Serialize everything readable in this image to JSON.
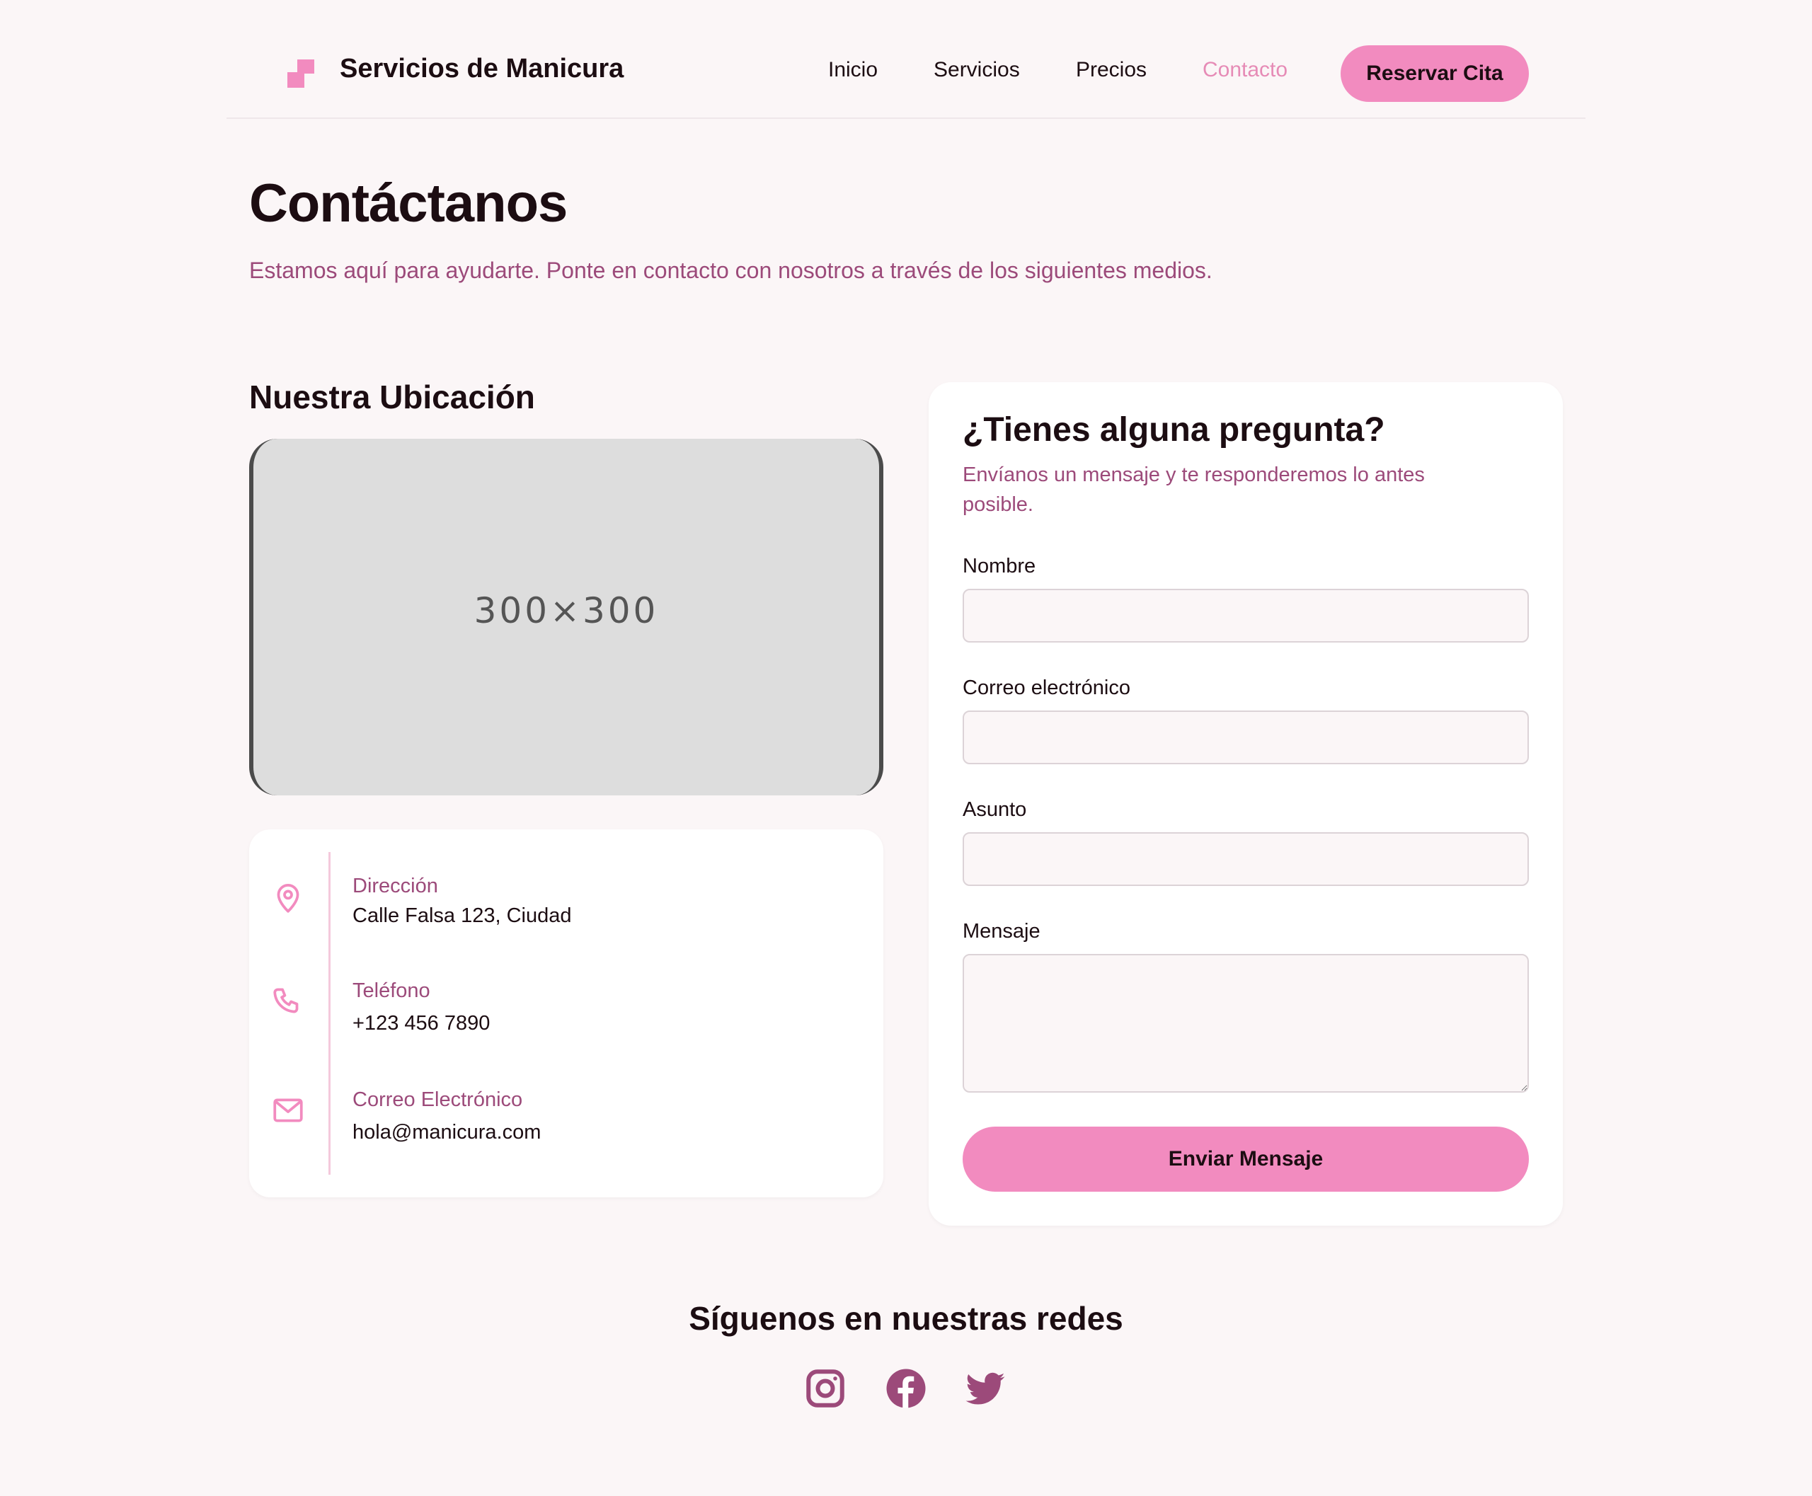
{
  "header": {
    "brand": "Servicios de Manicura",
    "nav": [
      {
        "label": "Inicio"
      },
      {
        "label": "Servicios"
      },
      {
        "label": "Precios"
      },
      {
        "label": "Contacto",
        "active": true
      }
    ],
    "cta_label": "Reservar Cita"
  },
  "hero": {
    "title": "Contáctanos",
    "subtitle": "Estamos aquí para ayudarte. Ponte en contacto con nosotros a través de los siguientes medios."
  },
  "location": {
    "title": "Nuestra Ubicación",
    "map_placeholder": "300×300"
  },
  "contact_info": [
    {
      "icon": "map-pin-icon",
      "label": "Dirección",
      "value": "Calle Falsa 123, Ciudad"
    },
    {
      "icon": "phone-icon",
      "label": "Teléfono",
      "value": "+123 456 7890"
    },
    {
      "icon": "mail-icon",
      "label": "Correo Electrónico",
      "value": "hola@manicura.com"
    }
  ],
  "form": {
    "title": "¿Tienes alguna pregunta?",
    "subtitle": "Envíanos un mensaje y te responderemos lo antes posible.",
    "fields": {
      "name": {
        "label": "Nombre",
        "value": ""
      },
      "email": {
        "label": "Correo electrónico",
        "value": ""
      },
      "subject": {
        "label": "Asunto",
        "value": ""
      },
      "message": {
        "label": "Mensaje",
        "value": ""
      }
    },
    "submit_label": "Enviar Mensaje"
  },
  "social": {
    "title": "Síguenos en nuestras redes",
    "icons": [
      "instagram-icon",
      "facebook-icon",
      "twitter-icon"
    ]
  },
  "colors": {
    "accent": "#f28bbf",
    "muted_text": "#9c4a7a",
    "background": "#fbf6f7",
    "social_icon": "#9c4a7a"
  }
}
